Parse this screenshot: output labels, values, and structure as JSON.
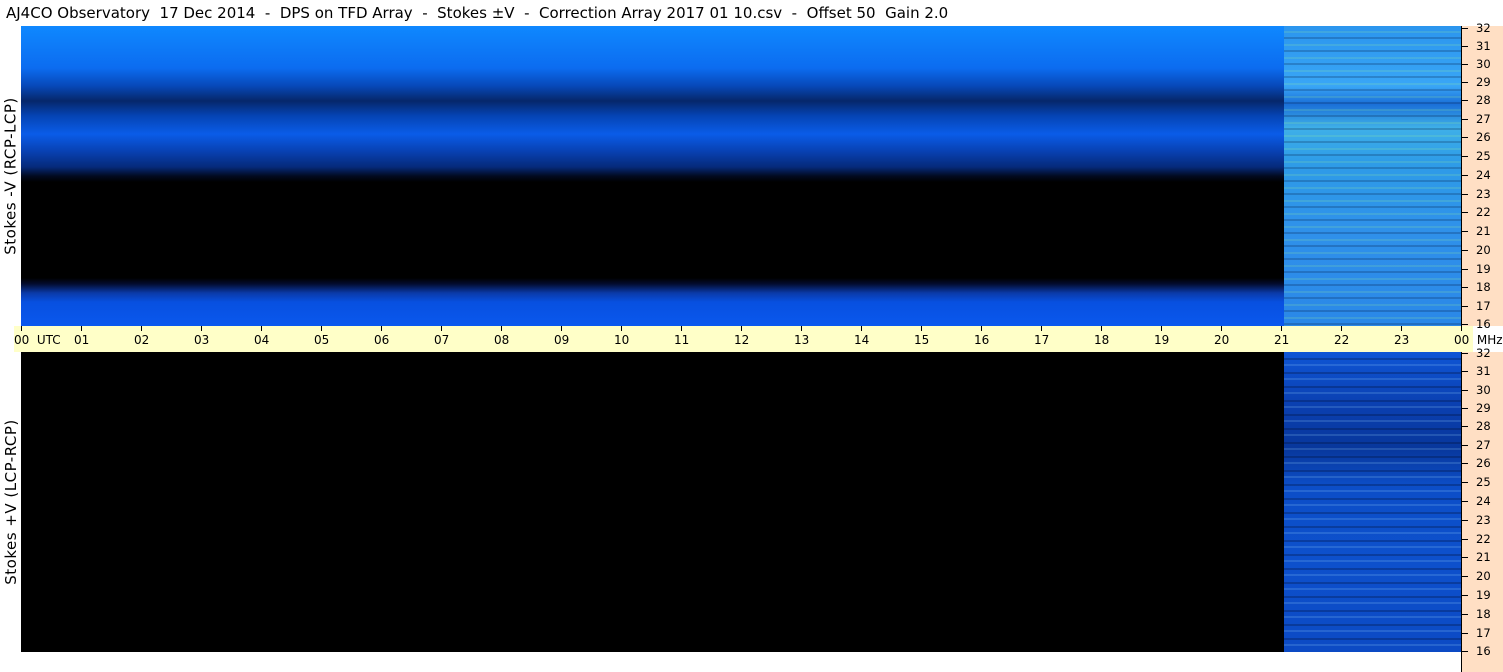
{
  "title": "AJ4CO Observatory  17 Dec 2014  -  DPS on TFD Array  -  Stokes ±V  -  Correction Array 2017 01 10.csv  -  Offset 50  Gain 2.0",
  "panels": {
    "top_label": "Stokes -V (RCP-LCP)",
    "bottom_label": "Stokes +V (LCP-RCP)"
  },
  "time_axis": {
    "labels": [
      "00  UTC",
      "01",
      "02",
      "03",
      "04",
      "05",
      "06",
      "07",
      "08",
      "09",
      "10",
      "11",
      "12",
      "13",
      "14",
      "15",
      "16",
      "17",
      "18",
      "19",
      "20",
      "21",
      "22",
      "23",
      "00  MHz"
    ]
  },
  "freq_axis": {
    "labels": [
      "32",
      "31",
      "30",
      "29",
      "28",
      "27",
      "26",
      "25",
      "24",
      "23",
      "22",
      "21",
      "20",
      "19",
      "18",
      "17",
      "16"
    ]
  },
  "colors": {
    "title_bg": "#ffffff",
    "time_axis_bg": "#ffffc8",
    "freq_axis_bg": "#ffdfc4",
    "spectrum_blue": "#0a6cff",
    "spectrum_dark": "#000000"
  }
}
